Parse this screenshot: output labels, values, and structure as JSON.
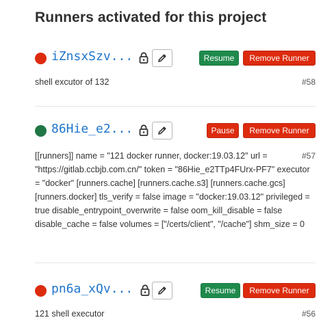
{
  "title": "Runners activated for this project",
  "runners": [
    {
      "token": "iZnsxSzv...",
      "status_color": "#dd2b0e",
      "toggle_label": "Resume",
      "remove_label": "Remove Runner",
      "description": "shell excutor of 132",
      "id": "#58"
    },
    {
      "token": "86Hie_e2...",
      "status_color": "#217645",
      "toggle_label": "Pause",
      "remove_label": "Remove Runner",
      "description": "[[runners]] name = \"121 docker runner, docker:19.03.12\" url = \"https://gitlab.ccbjb.com.cn/\" token = \"86Hie_e2TTp4FUrx-PF7\" executor = \"docker\" [runners.cache] [runners.cache.s3] [runners.cache.gcs] [runners.docker] tls_verify = false image = \"docker:19.03.12\" privileged = true disable_entrypoint_overwrite = false oom_kill_disable = false disable_cache = false volumes = [\"/certs/client\", \"/cache\"] shm_size = 0",
      "id": "#57"
    },
    {
      "token": "pn6a_xQv...",
      "status_color": "#dd2b0e",
      "toggle_label": "Resume",
      "remove_label": "Remove Runner",
      "description": "121 shell executor",
      "id": "#56"
    }
  ]
}
